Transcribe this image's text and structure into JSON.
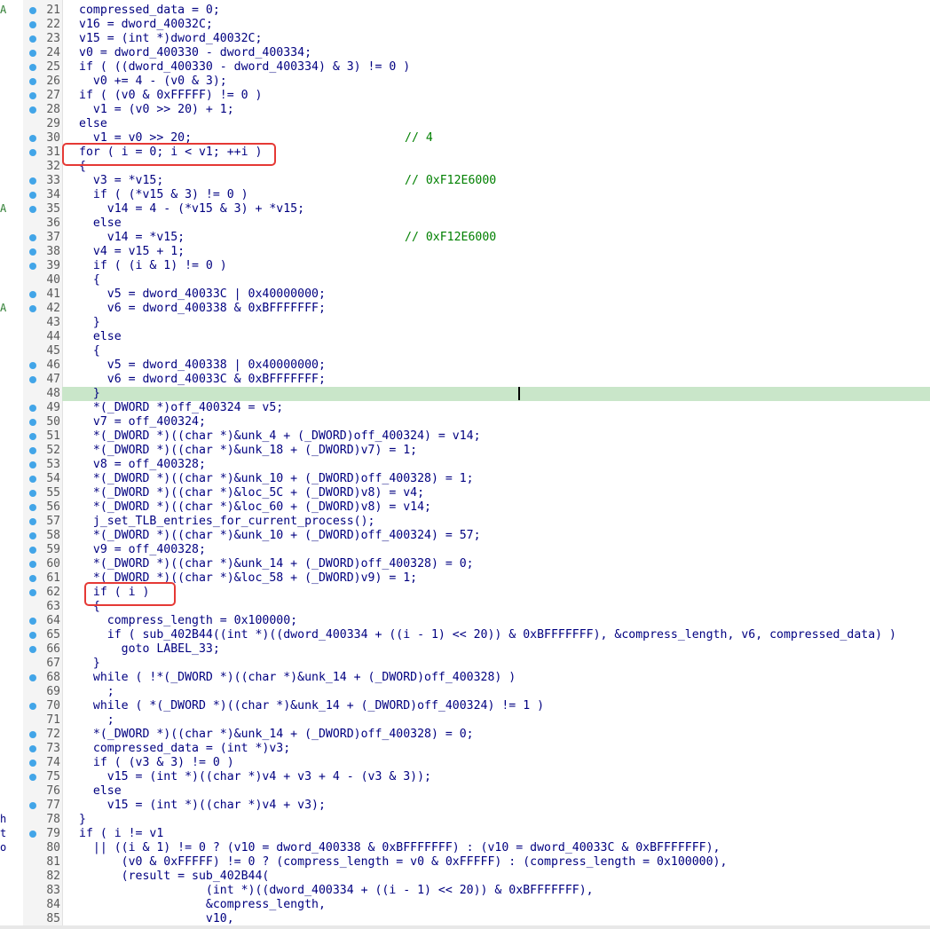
{
  "colors": {
    "code_text": "#000080",
    "comment": "#008000",
    "line_number": "#5a5a5a",
    "breakpoint_dot": "#42a5e8",
    "current_line_highlight": "#c9e6c9",
    "annotation_box": "#e53935"
  },
  "icons": {
    "breakpoint": "breakpoint-dot-icon"
  },
  "left_strip_marks": [
    "A",
    "A",
    "A",
    "h",
    "t",
    "o"
  ],
  "current_line": 48,
  "annotations": [
    "for-loop-box",
    "if-i-box"
  ],
  "lines": [
    {
      "n": 21,
      "dot": true,
      "text": "compressed_data = 0;"
    },
    {
      "n": 22,
      "dot": true,
      "text": "v16 = dword_40032C;"
    },
    {
      "n": 23,
      "dot": true,
      "text": "v15 = (int *)dword_40032C;"
    },
    {
      "n": 24,
      "dot": true,
      "text": "v0 = dword_400330 - dword_400334;"
    },
    {
      "n": 25,
      "dot": true,
      "text": "if ( ((dword_400330 - dword_400334) & 3) != 0 )"
    },
    {
      "n": 26,
      "dot": true,
      "text": "  v0 += 4 - (v0 & 3);"
    },
    {
      "n": 27,
      "dot": true,
      "text": "if ( (v0 & 0xFFFFF) != 0 )"
    },
    {
      "n": 28,
      "dot": true,
      "text": "  v1 = (v0 >> 20) + 1;"
    },
    {
      "n": 29,
      "dot": false,
      "text": "else"
    },
    {
      "n": 30,
      "dot": true,
      "text": "  v1 = v0 >> 20;",
      "comment": "// 4"
    },
    {
      "n": 31,
      "dot": true,
      "text": "for ( i = 0; i < v1; ++i )"
    },
    {
      "n": 32,
      "dot": false,
      "text": "{"
    },
    {
      "n": 33,
      "dot": true,
      "text": "  v3 = *v15;",
      "comment": "// 0xF12E6000"
    },
    {
      "n": 34,
      "dot": true,
      "text": "  if ( (*v15 & 3) != 0 )"
    },
    {
      "n": 35,
      "dot": true,
      "text": "    v14 = 4 - (*v15 & 3) + *v15;"
    },
    {
      "n": 36,
      "dot": false,
      "text": "  else"
    },
    {
      "n": 37,
      "dot": true,
      "text": "    v14 = *v15;",
      "comment": "// 0xF12E6000"
    },
    {
      "n": 38,
      "dot": true,
      "text": "  v4 = v15 + 1;"
    },
    {
      "n": 39,
      "dot": true,
      "text": "  if ( (i & 1) != 0 )"
    },
    {
      "n": 40,
      "dot": false,
      "text": "  {"
    },
    {
      "n": 41,
      "dot": true,
      "text": "    v5 = dword_40033C | 0x40000000;"
    },
    {
      "n": 42,
      "dot": true,
      "text": "    v6 = dword_400338 & 0xBFFFFFFF;"
    },
    {
      "n": 43,
      "dot": false,
      "text": "  }"
    },
    {
      "n": 44,
      "dot": false,
      "text": "  else"
    },
    {
      "n": 45,
      "dot": false,
      "text": "  {"
    },
    {
      "n": 46,
      "dot": true,
      "text": "    v5 = dword_400338 | 0x40000000;"
    },
    {
      "n": 47,
      "dot": true,
      "text": "    v6 = dword_40033C & 0xBFFFFFFF;"
    },
    {
      "n": 48,
      "dot": false,
      "text": "  }"
    },
    {
      "n": 49,
      "dot": true,
      "text": "  *(_DWORD *)off_400324 = v5;"
    },
    {
      "n": 50,
      "dot": true,
      "text": "  v7 = off_400324;"
    },
    {
      "n": 51,
      "dot": true,
      "text": "  *(_DWORD *)((char *)&unk_4 + (_DWORD)off_400324) = v14;"
    },
    {
      "n": 52,
      "dot": true,
      "text": "  *(_DWORD *)((char *)&unk_18 + (_DWORD)v7) = 1;"
    },
    {
      "n": 53,
      "dot": true,
      "text": "  v8 = off_400328;"
    },
    {
      "n": 54,
      "dot": true,
      "text": "  *(_DWORD *)((char *)&unk_10 + (_DWORD)off_400328) = 1;"
    },
    {
      "n": 55,
      "dot": true,
      "text": "  *(_DWORD *)((char *)&loc_5C + (_DWORD)v8) = v4;"
    },
    {
      "n": 56,
      "dot": true,
      "text": "  *(_DWORD *)((char *)&loc_60 + (_DWORD)v8) = v14;"
    },
    {
      "n": 57,
      "dot": true,
      "text": "  j_set_TLB_entries_for_current_process();"
    },
    {
      "n": 58,
      "dot": true,
      "text": "  *(_DWORD *)((char *)&unk_10 + (_DWORD)off_400324) = 57;"
    },
    {
      "n": 59,
      "dot": true,
      "text": "  v9 = off_400328;"
    },
    {
      "n": 60,
      "dot": true,
      "text": "  *(_DWORD *)((char *)&unk_14 + (_DWORD)off_400328) = 0;"
    },
    {
      "n": 61,
      "dot": true,
      "text": "  *(_DWORD *)((char *)&loc_58 + (_DWORD)v9) = 1;"
    },
    {
      "n": 62,
      "dot": true,
      "text": "  if ( i )"
    },
    {
      "n": 63,
      "dot": false,
      "text": "  {"
    },
    {
      "n": 64,
      "dot": true,
      "text": "    compress_length = 0x100000;"
    },
    {
      "n": 65,
      "dot": true,
      "text": "    if ( sub_402B44((int *)((dword_400334 + ((i - 1) << 20)) & 0xBFFFFFFF), &compress_length, v6, compressed_data) )"
    },
    {
      "n": 66,
      "dot": true,
      "text": "      goto LABEL_33;"
    },
    {
      "n": 67,
      "dot": false,
      "text": "  }"
    },
    {
      "n": 68,
      "dot": true,
      "text": "  while ( !*(_DWORD *)((char *)&unk_14 + (_DWORD)off_400328) )"
    },
    {
      "n": 69,
      "dot": false,
      "text": "    ;"
    },
    {
      "n": 70,
      "dot": true,
      "text": "  while ( *(_DWORD *)((char *)&unk_14 + (_DWORD)off_400324) != 1 )"
    },
    {
      "n": 71,
      "dot": false,
      "text": "    ;"
    },
    {
      "n": 72,
      "dot": true,
      "text": "  *(_DWORD *)((char *)&unk_14 + (_DWORD)off_400328) = 0;"
    },
    {
      "n": 73,
      "dot": true,
      "text": "  compressed_data = (int *)v3;"
    },
    {
      "n": 74,
      "dot": true,
      "text": "  if ( (v3 & 3) != 0 )"
    },
    {
      "n": 75,
      "dot": true,
      "text": "    v15 = (int *)((char *)v4 + v3 + 4 - (v3 & 3));"
    },
    {
      "n": 76,
      "dot": false,
      "text": "  else"
    },
    {
      "n": 77,
      "dot": true,
      "text": "    v15 = (int *)((char *)v4 + v3);"
    },
    {
      "n": 78,
      "dot": false,
      "text": "}"
    },
    {
      "n": 79,
      "dot": true,
      "text": "if ( i != v1"
    },
    {
      "n": 80,
      "dot": false,
      "text": "  || ((i & 1) != 0 ? (v10 = dword_400338 & 0xBFFFFFFF) : (v10 = dword_40033C & 0xBFFFFFFF),"
    },
    {
      "n": 81,
      "dot": false,
      "text": "      (v0 & 0xFFFFF) != 0 ? (compress_length = v0 & 0xFFFFF) : (compress_length = 0x100000),"
    },
    {
      "n": 82,
      "dot": false,
      "text": "      (result = sub_402B44("
    },
    {
      "n": 83,
      "dot": false,
      "text": "                  (int *)((dword_400334 + ((i - 1) << 20)) & 0xBFFFFFFF),"
    },
    {
      "n": 84,
      "dot": false,
      "text": "                  &compress_length,"
    },
    {
      "n": 85,
      "dot": false,
      "text": "                  v10,"
    }
  ]
}
